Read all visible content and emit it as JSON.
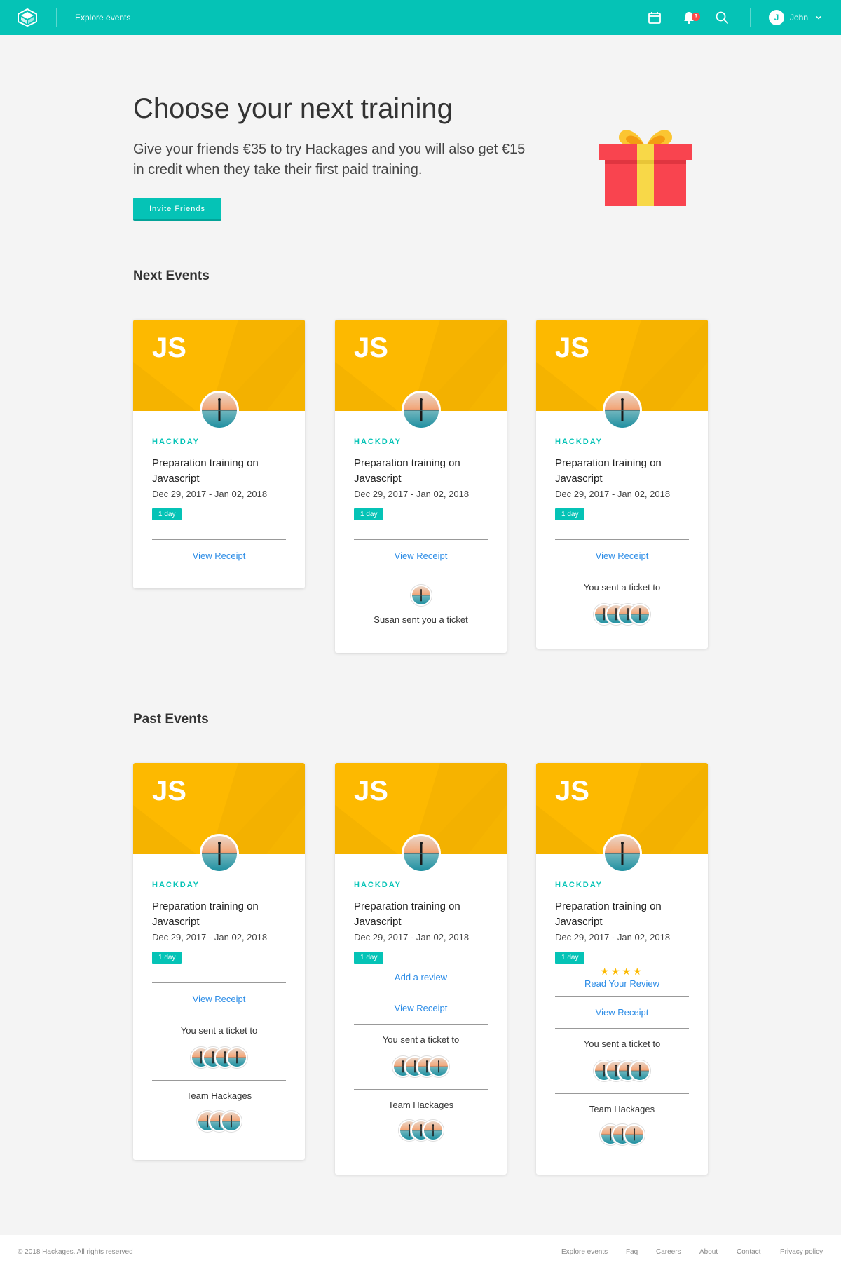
{
  "header": {
    "explore_label": "Explore events",
    "notification_count": "3",
    "user_initial": "J",
    "user_name": "John"
  },
  "hero": {
    "title": "Choose your next training",
    "text": "Give your friends €35 to try Hackages and you will also get €15 in credit when they take their first paid training.",
    "invite_label": "Invite Friends"
  },
  "sections": {
    "next_title": "Next Events",
    "past_title": "Past Events"
  },
  "cards": {
    "banner_label": "JS",
    "tag": "HACKDAY",
    "title": "Preparation training on Javascript",
    "dates": "Dec 29, 2017 - Jan 02, 2018",
    "duration": "1 day",
    "view_receipt": "View Receipt",
    "add_review": "Add a review",
    "read_review": "Read Your Review",
    "rating_stars": 4,
    "stars_text": "★★★★",
    "received_ticket": "Susan sent you a ticket",
    "sent_ticket": "You sent a ticket to",
    "team": "Team Hackages"
  },
  "footer": {
    "copyright": "© 2018 Hackages. All rights reserved",
    "links": [
      "Explore events",
      "Faq",
      "Careers",
      "About",
      "Contact",
      "Privacy policy"
    ]
  },
  "colors": {
    "brand": "#05c3b6",
    "banner": "#fdb900",
    "link": "#2a8be6",
    "notification": "#ff4a4a"
  }
}
